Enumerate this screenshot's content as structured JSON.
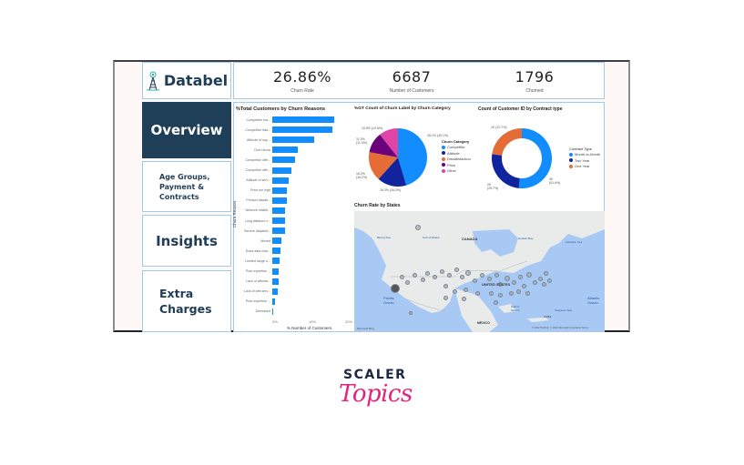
{
  "header": {
    "logo_text": "Databel",
    "kpis": [
      {
        "value": "26.86%",
        "label": "Churn Rate"
      },
      {
        "value": "6687",
        "label": "Number of Customers"
      },
      {
        "value": "1796",
        "label": "Churned"
      }
    ]
  },
  "nav": {
    "items": [
      {
        "label": "Overview",
        "active": true
      },
      {
        "label": "Age Groups, Payment & Contracts",
        "active": false
      },
      {
        "label": "Insights",
        "active": false
      },
      {
        "label": "Extra Charges",
        "active": false
      }
    ]
  },
  "chart_data": [
    {
      "type": "bar",
      "orientation": "horizontal",
      "title": "%Total Customers by Churn Reasons",
      "xlabel": "% Number of Customers",
      "ylabel": "Churn Reason",
      "xlim": [
        0,
        20
      ],
      "xticks": [
        "0%",
        "10%",
        "20%"
      ],
      "categories": [
        "Competitor ma...",
        "Competitor had...",
        "Attitude of sup...",
        "Don't know",
        "Competitor offe...",
        "Competitor offe...",
        "Attitude of serv...",
        "Price too high",
        "Product dissati...",
        "Network reliabil...",
        "Long distance c...",
        "Service dissatisf...",
        "Moved",
        "Extra data char...",
        "Limited range o...",
        "Poor expertise ...",
        "Lack of afforda...",
        "Lack of self-serv...",
        "Poor expertise ...",
        "Deceased"
      ],
      "values": [
        17.0,
        16.6,
        11.4,
        7.1,
        6.2,
        5.3,
        4.6,
        4.1,
        4.0,
        3.6,
        3.5,
        3.5,
        2.6,
        2.2,
        2.1,
        1.8,
        1.7,
        1.5,
        0.7,
        0.3
      ]
    },
    {
      "type": "pie",
      "title": "%GT Count of Churn Label by Churn Category",
      "legend_title": "Churn Category",
      "legend_position": "right",
      "categories": [
        "Competitor",
        "Attitude",
        "Dissatisfaction",
        "Price",
        "Other"
      ],
      "values": [
        45.1,
        16.2,
        16.2,
        11.3,
        10.6
      ],
      "labels": [
        "45.1% (45.1%)",
        "16.2% (16.2%)",
        "16.2% (16.2%)",
        "11.3% (11.3%)",
        "10.6% (10.6%)"
      ],
      "colors": [
        "#118dff",
        "#12239e",
        "#e66c37",
        "#6b007b",
        "#e044a7"
      ]
    },
    {
      "type": "pie",
      "donut": true,
      "title": "Count of Customer ID by Contract type",
      "legend_title": "Contract Type",
      "legend_position": "right",
      "categories": [
        "Month-to-Month",
        "Two Year",
        "One Year"
      ],
      "values": [
        51.6,
        25.7,
        22.7
      ],
      "labels": [
        "3K (51.6%)",
        "2K (25.7%)",
        "1K (22.7%)"
      ],
      "colors": [
        "#118dff",
        "#12239e",
        "#e66c37"
      ]
    }
  ],
  "map": {
    "title": "Churn Rate by States",
    "labels": {
      "canada": "CANADA",
      "us": "UNITED STATES",
      "mexico": "MEXICO",
      "pacific": "Pacific Ocean",
      "atlantic": "Atlantic Ocean",
      "bering": "Bering Sea",
      "alaska": "Gulf of Alaska",
      "hudson": "Hudson Bay",
      "labrador": "Labrador Sea",
      "gulf": "Gulf of Mexico",
      "sargasso": "Sargasso Sea",
      "cuba": "CUBA"
    },
    "attribution": "Microsoft Bing",
    "copyright": "© 2022 TomTom, © 2022 Microsoft Corporation  Terms"
  },
  "branding": {
    "line1": "SCALER",
    "line2": "Topics"
  }
}
